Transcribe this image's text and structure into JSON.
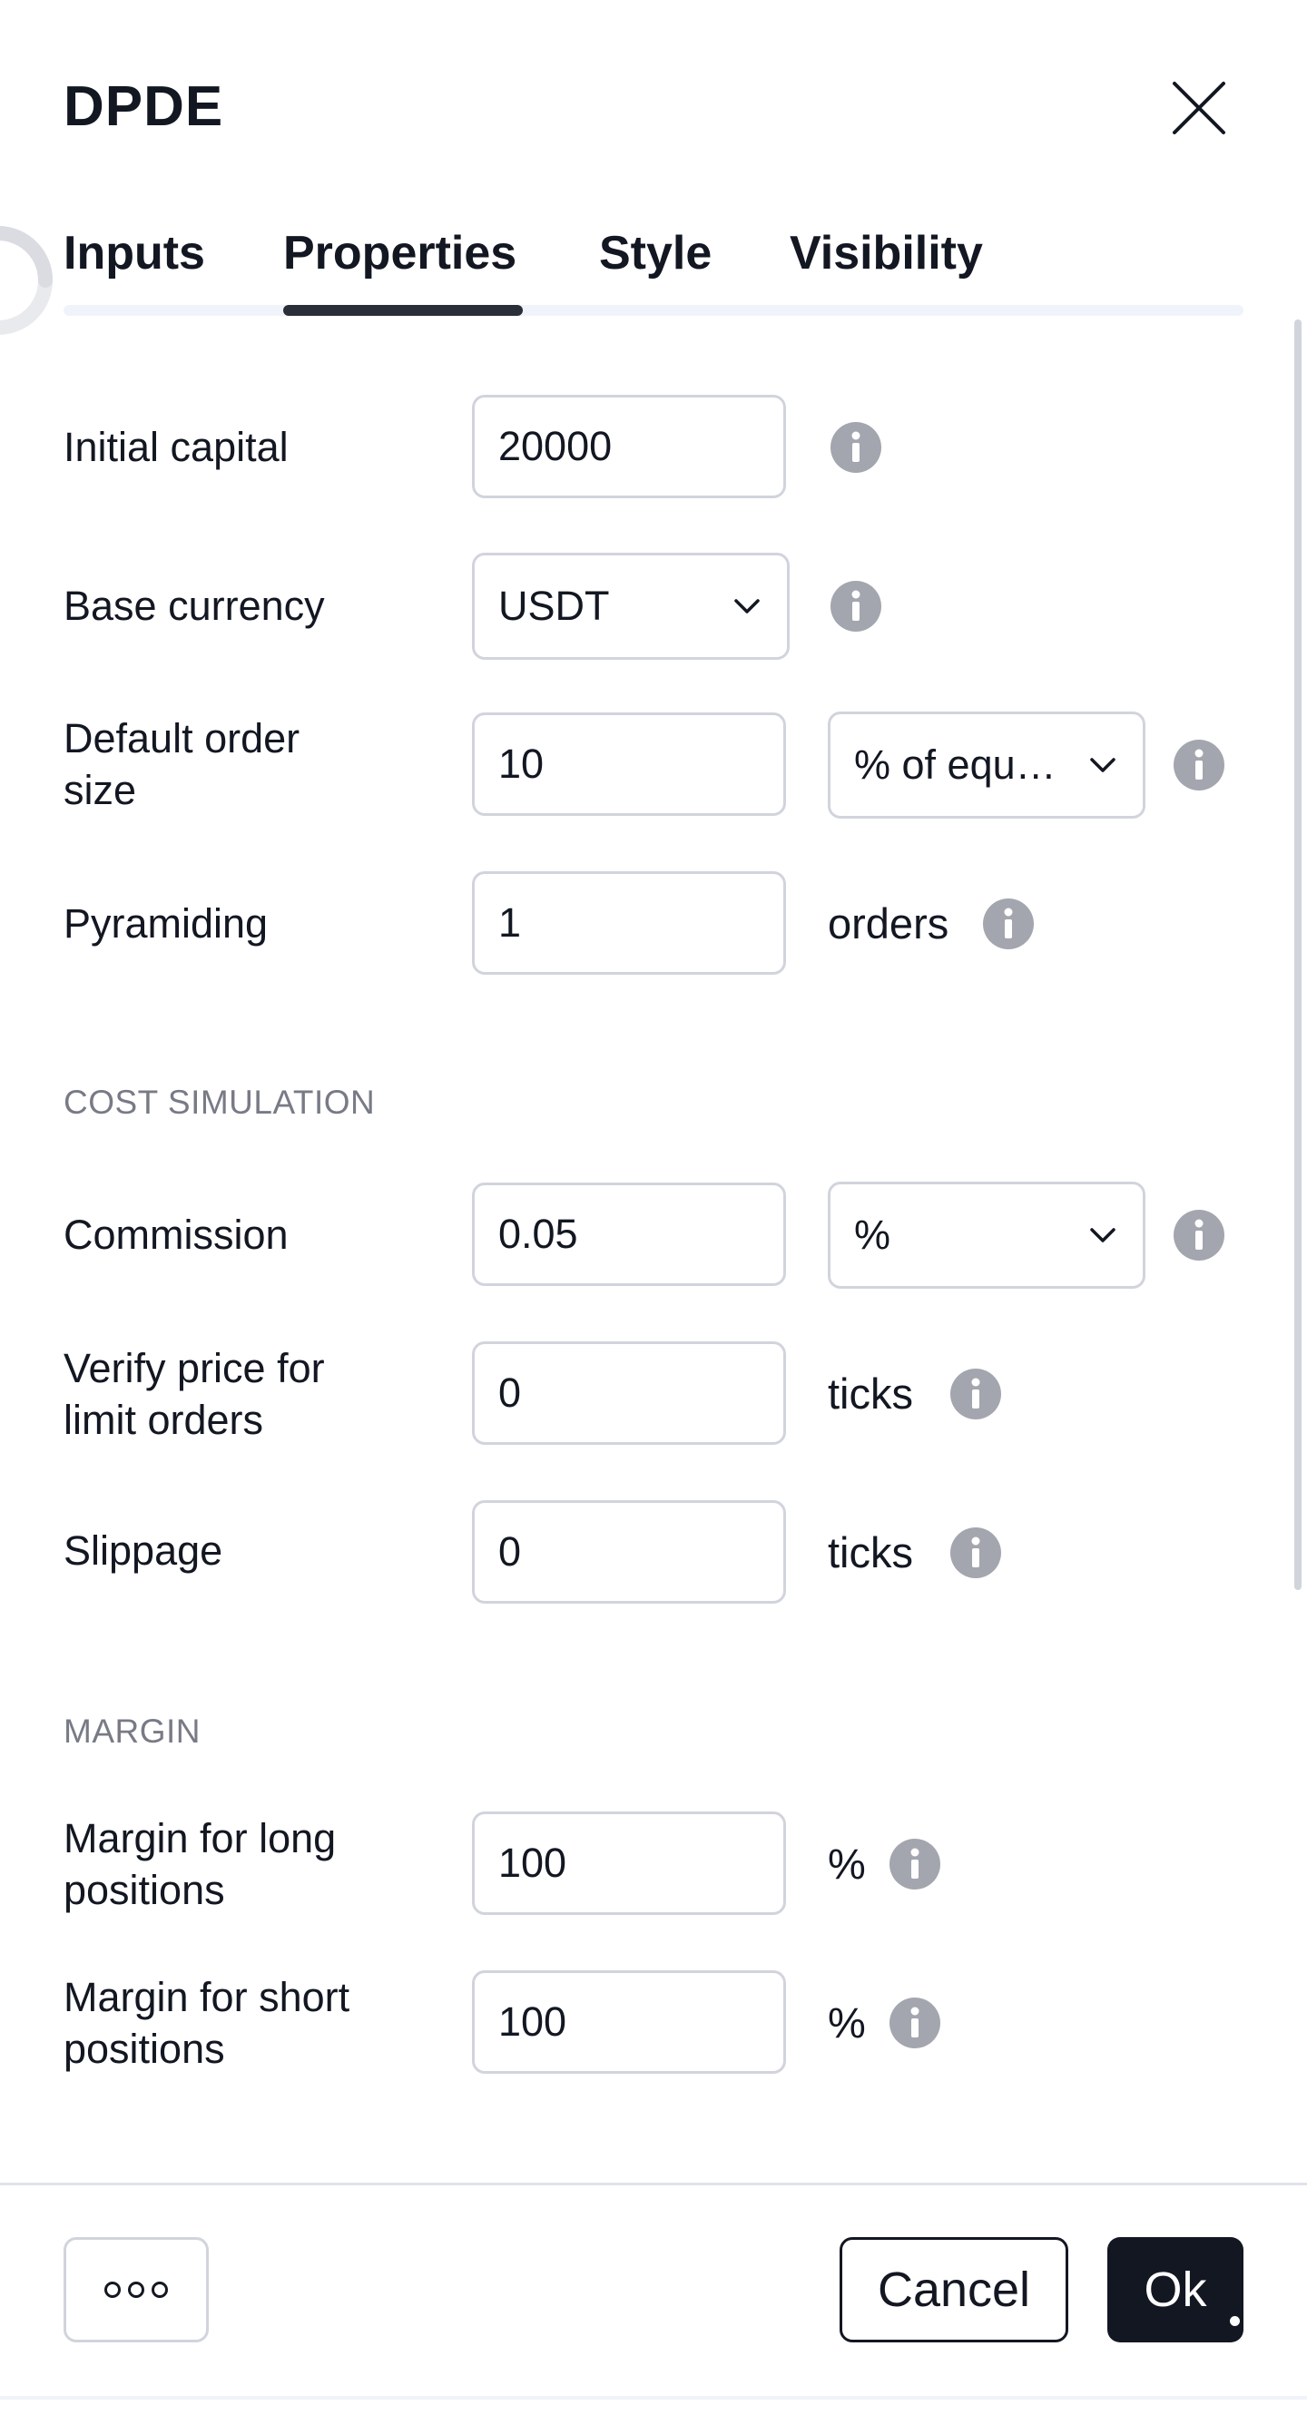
{
  "dialog": {
    "title": "DPDE"
  },
  "tabs": [
    {
      "label": "Inputs",
      "active": false
    },
    {
      "label": "Properties",
      "active": true
    },
    {
      "label": "Style",
      "active": false
    },
    {
      "label": "Visibility",
      "active": false
    }
  ],
  "properties": {
    "initial_capital": {
      "label": "Initial capital",
      "value": "20000"
    },
    "base_currency": {
      "label": "Base currency",
      "value": "USDT"
    },
    "default_order_size": {
      "label_line1": "Default order",
      "label_line2": "size",
      "value": "10",
      "unit": "% of equ…"
    },
    "pyramiding": {
      "label": "Pyramiding",
      "value": "1",
      "unit": "orders"
    }
  },
  "cost_simulation": {
    "heading": "COST SIMULATION",
    "commission": {
      "label": "Commission",
      "value": "0.05",
      "unit": "%"
    },
    "verify_price": {
      "label_line1": "Verify price for",
      "label_line2": "limit orders",
      "value": "0",
      "unit": "ticks"
    },
    "slippage": {
      "label": "Slippage",
      "value": "0",
      "unit": "ticks"
    }
  },
  "margin": {
    "heading": "MARGIN",
    "long": {
      "label_line1": "Margin for long",
      "label_line2": "positions",
      "value": "100",
      "unit": "%"
    },
    "short": {
      "label_line1": "Margin for short",
      "label_line2": "positions",
      "value": "100",
      "unit": "%"
    }
  },
  "footer": {
    "cancel_label": "Cancel",
    "ok_label": "Ok"
  },
  "icons": {
    "close": "close-icon",
    "info": "info-icon",
    "chevron": "chevron-down-icon",
    "more": "more-horizontal-icon",
    "spinner": "loading-spinner-icon"
  },
  "colors": {
    "text": "#131722",
    "muted": "#787b86",
    "border": "#d1d4dc",
    "info_icon": "#a3a6af",
    "primary_button": "#131722"
  }
}
